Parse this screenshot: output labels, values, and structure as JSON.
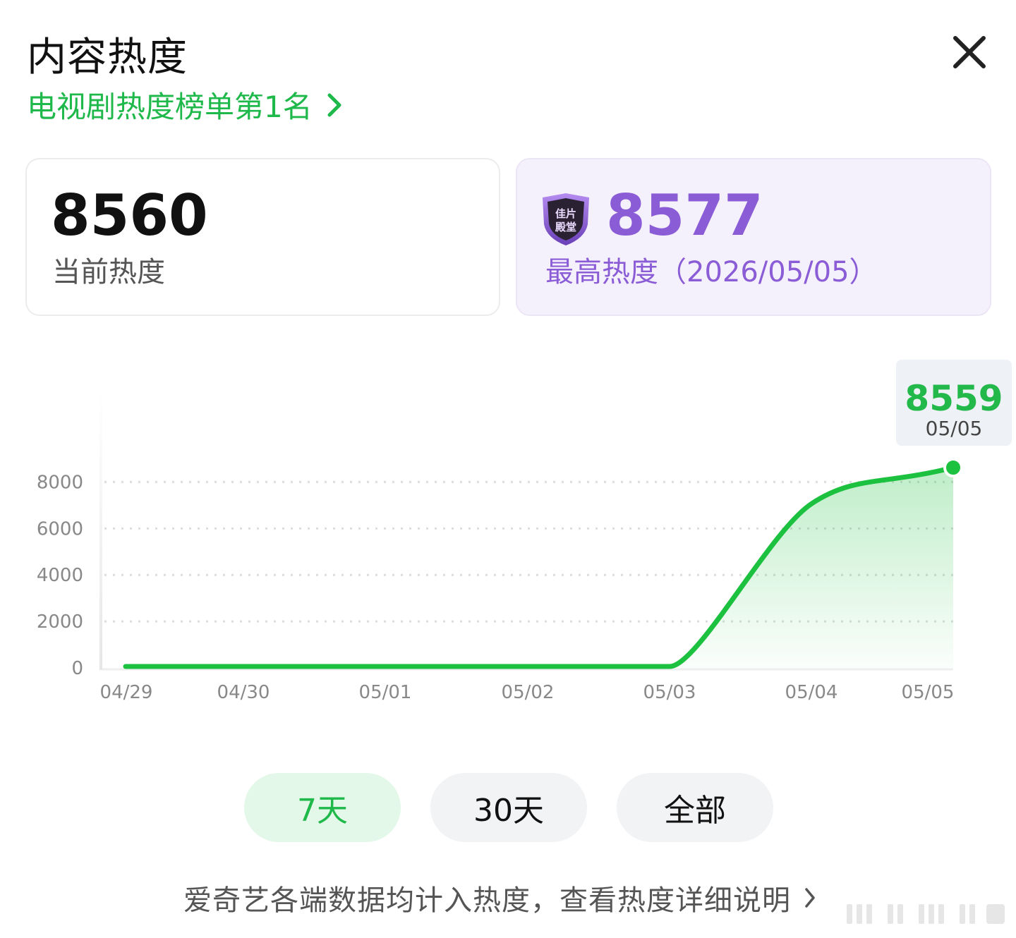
{
  "header": {
    "title": "内容热度",
    "rank_link": "电视剧热度榜单第1名"
  },
  "cards": {
    "current": {
      "value": "8560",
      "label": "当前热度"
    },
    "peak": {
      "value": "8577",
      "label": "最高热度（2026/05/05）",
      "badge_text": "佳片殿堂"
    }
  },
  "tooltip": {
    "value": "8559",
    "date": "05/05"
  },
  "chart_data": {
    "type": "area",
    "x": [
      "04/29",
      "04/30",
      "05/01",
      "05/02",
      "05/03",
      "05/04",
      "05/05"
    ],
    "series": [
      {
        "values": [
          0,
          0,
          0,
          0,
          0,
          7000,
          8559
        ]
      }
    ],
    "y_ticks": [
      0,
      2000,
      4000,
      6000,
      8000
    ],
    "ylim": [
      0,
      8559
    ],
    "grid": true,
    "line_color": "#1cc13f",
    "fill_color": "#1cc13f"
  },
  "tabs": [
    {
      "label": "7天",
      "active": true
    },
    {
      "label": "30天",
      "active": false
    },
    {
      "label": "全部",
      "active": false
    }
  ],
  "footer": {
    "text": "爱奇艺各端数据均计入热度，查看热度详细说明"
  },
  "colors": {
    "accent_green": "#1fb84a",
    "peak_purple": "#8a5cd6"
  }
}
